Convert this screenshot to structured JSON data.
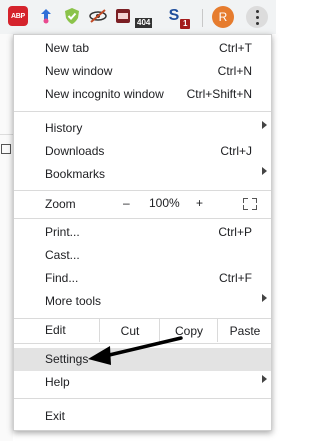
{
  "toolbar": {
    "extensions": [
      {
        "name": "abp-icon",
        "label": "ABP"
      },
      {
        "name": "puzzle-icon"
      },
      {
        "name": "shield-check-icon"
      },
      {
        "name": "eye-slash-icon"
      },
      {
        "name": "calendar-icon",
        "badge": "404"
      },
      {
        "name": "s-icon",
        "badge": "1"
      }
    ],
    "avatar_letter": "R"
  },
  "menu": {
    "new_tab": {
      "label": "New tab",
      "shortcut": "Ctrl+T"
    },
    "new_window": {
      "label": "New window",
      "shortcut": "Ctrl+N"
    },
    "new_incognito": {
      "label": "New incognito window",
      "shortcut": "Ctrl+Shift+N"
    },
    "history": {
      "label": "History"
    },
    "downloads": {
      "label": "Downloads",
      "shortcut": "Ctrl+J"
    },
    "bookmarks": {
      "label": "Bookmarks"
    },
    "zoom": {
      "label": "Zoom",
      "minus": "–",
      "level": "100%",
      "plus": "+"
    },
    "print": {
      "label": "Print...",
      "shortcut": "Ctrl+P"
    },
    "cast": {
      "label": "Cast..."
    },
    "find": {
      "label": "Find...",
      "shortcut": "Ctrl+F"
    },
    "more_tools": {
      "label": "More tools"
    },
    "edit": {
      "label": "Edit",
      "cut": "Cut",
      "copy": "Copy",
      "paste": "Paste"
    },
    "settings": {
      "label": "Settings"
    },
    "help": {
      "label": "Help"
    },
    "exit": {
      "label": "Exit"
    }
  },
  "colors": {
    "accent_avatar": "#e67c2e",
    "abp": "#d5232c",
    "highlight": "#e3e3e3"
  }
}
